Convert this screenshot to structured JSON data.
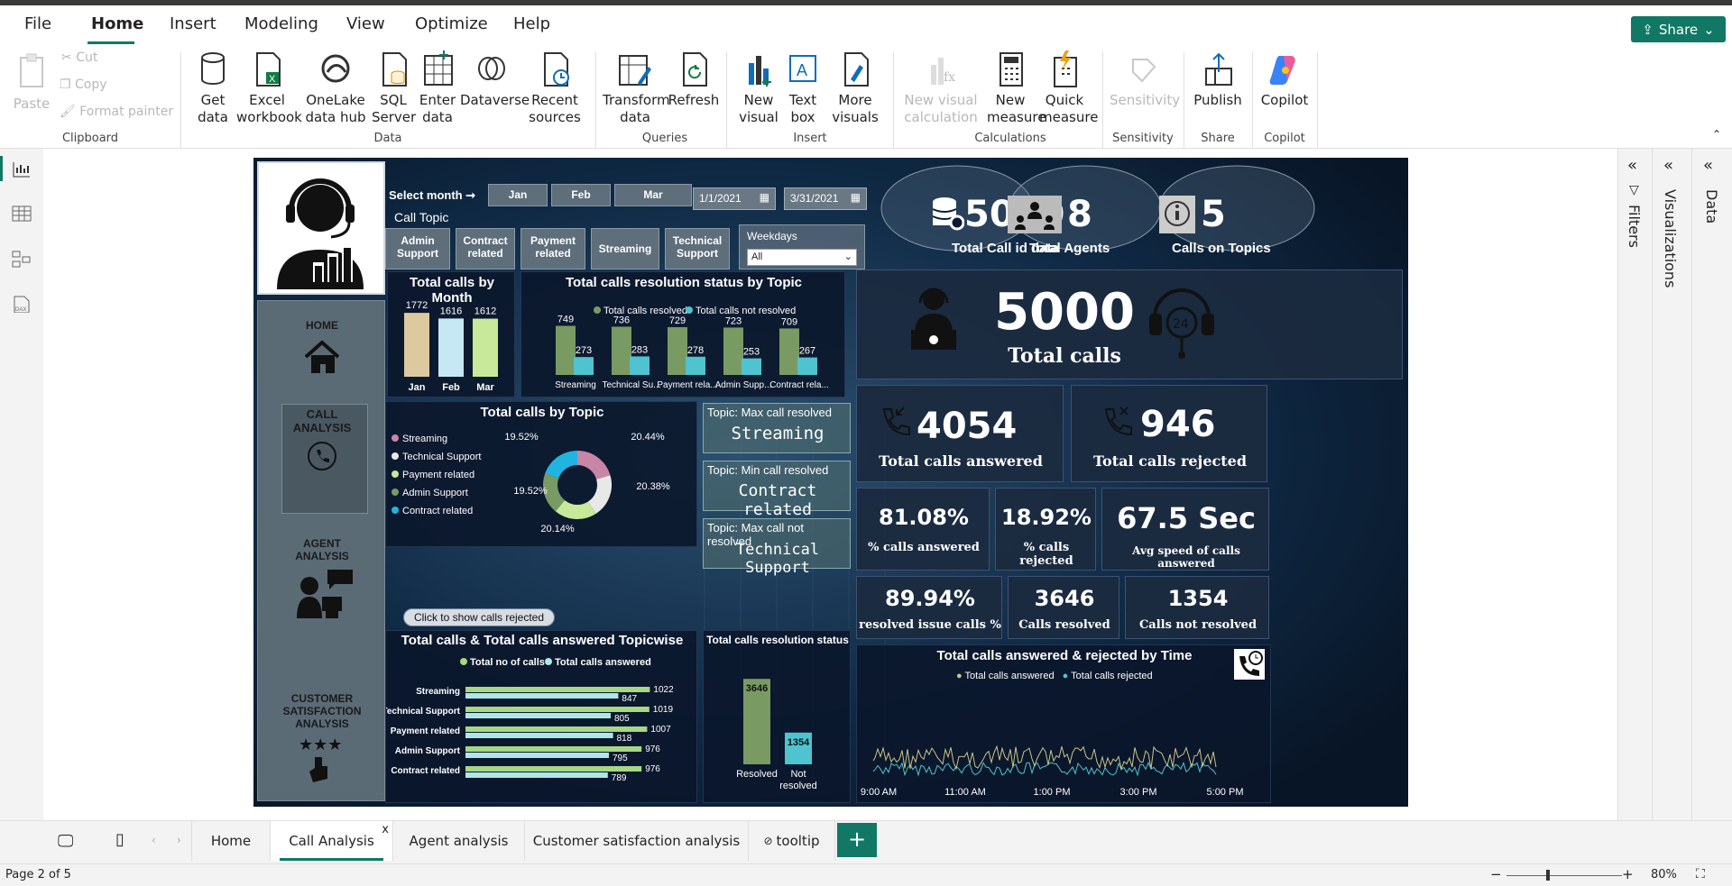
{
  "menu": {
    "file": "File",
    "home": "Home",
    "insert": "Insert",
    "modeling": "Modeling",
    "view": "View",
    "optimize": "Optimize",
    "help": "Help",
    "share": "Share"
  },
  "ribbon": {
    "paste": "Paste",
    "cut": "Cut",
    "copy": "Copy",
    "format_painter": "Format painter",
    "get_data": "Get data",
    "excel": "Excel workbook",
    "onelake": "OneLake data hub",
    "sql": "SQL Server",
    "enter_data": "Enter data",
    "dataverse": "Dataverse",
    "recent": "Recent sources",
    "transform": "Transform data",
    "refresh": "Refresh",
    "new_visual": "New visual",
    "text_box": "Text box",
    "more_visuals": "More visuals",
    "new_visual_calc": "New visual calculation",
    "new_measure": "New measure",
    "quick_measure": "Quick measure",
    "sensitivity": "Sensitivity",
    "publish": "Publish",
    "copilot": "Copilot",
    "groups": {
      "clipboard": "Clipboard",
      "data": "Data",
      "queries": "Queries",
      "insert": "Insert",
      "calculations": "Calculations",
      "sensitivity": "Sensitivity",
      "share": "Share",
      "copilot": "Copilot"
    }
  },
  "report": {
    "select_month": "Select month",
    "months": [
      "Jan",
      "Feb",
      "Mar"
    ],
    "date_from": "1/1/2021",
    "date_to": "3/31/2021",
    "call_topic_label": "Call Topic",
    "topics": [
      "Admin Support",
      "Contract related",
      "Payment related",
      "Streaming",
      "Technical Support"
    ],
    "weekdays_label": "Weekdays",
    "weekdays_value": "All",
    "nav": {
      "home": "HOME",
      "call": "CALL ANALYSIS",
      "agent": "AGENT ANALYSIS",
      "csat": "CUSTOMER SATISFACTION ANALYSIS"
    },
    "kpi_top": [
      {
        "value": "5000",
        "label": "Total Call id data"
      },
      {
        "value": "8",
        "label": "Total Agents"
      },
      {
        "value": "5",
        "label": "Calls on Topics"
      }
    ],
    "total_calls": {
      "value": "5000",
      "label": "Total calls"
    },
    "answered": {
      "value": "4054",
      "label": "Total calls answered"
    },
    "rejected": {
      "value": "946",
      "label": "Total calls rejected"
    },
    "pct_answered": {
      "value": "81.08%",
      "label": "% calls answered"
    },
    "pct_rejected": {
      "value": "18.92%",
      "label": "% calls rejected"
    },
    "avg_speed": {
      "value": "67.5 Sec",
      "label": "Avg speed of calls answered"
    },
    "resolved_pct": {
      "value": "89.94%",
      "label": "resolved issue calls %"
    },
    "calls_resolved": {
      "value": "3646",
      "label": "Calls resolved"
    },
    "calls_not_resolved": {
      "value": "1354",
      "label": "Calls not resolved"
    },
    "max_resolved": {
      "title": "Topic: Max call resolved",
      "value": "Streaming"
    },
    "min_resolved": {
      "title": "Topic: Min call resolved",
      "value": "Contract related"
    },
    "max_not_resolved": {
      "title": "Topic: Max call not resolved",
      "value": "Technical Support"
    },
    "click_rejected": "Click to show calls rejected",
    "time_chart": {
      "title": "Total calls answered & rejected by Time",
      "legend": [
        "Total calls answered",
        "Total calls rejected"
      ],
      "ticks": [
        "9:00 AM",
        "11:00 AM",
        "1:00 PM",
        "3:00 PM",
        "5:00 PM"
      ]
    }
  },
  "chart_data": [
    {
      "type": "bar",
      "title": "Total calls by Month",
      "categories": [
        "Jan",
        "Feb",
        "Mar"
      ],
      "values": [
        1772,
        1616,
        1612
      ],
      "colors": [
        "#dcc9a0",
        "#c6e8f4",
        "#c8e89a"
      ]
    },
    {
      "type": "bar",
      "title": "Total calls resolution status by Topic",
      "categories": [
        "Streaming",
        "Technical Su...",
        "Payment rela...",
        "Admin Supp...",
        "Contract rela..."
      ],
      "series": [
        {
          "name": "Total  calls resolved",
          "values": [
            749,
            736,
            729,
            723,
            709
          ],
          "color": "#7a9a63"
        },
        {
          "name": "Total calls not resolved",
          "values": [
            273,
            283,
            278,
            253,
            267
          ],
          "color": "#4fc3d0"
        }
      ]
    },
    {
      "type": "pie",
      "title": "Total calls by Topic",
      "labels": [
        "Streaming",
        "Technical Support",
        "Payment related",
        "Admin Support",
        "Contract related"
      ],
      "values": [
        20.44,
        20.38,
        20.14,
        19.52,
        19.52
      ],
      "colors": [
        "#c985a6",
        "#e8e8e8",
        "#c8e89a",
        "#7a9a63",
        "#1fb5e0"
      ],
      "label_texts": [
        "20.44%",
        "20.38%",
        "20.14%",
        "19.52%",
        "19.52%"
      ]
    },
    {
      "type": "bar",
      "title": "Total calls & Total calls answered Topicwise",
      "categories": [
        "Streaming",
        "Technical Support",
        "Payment related",
        "Admin Support",
        "Contract related"
      ],
      "series": [
        {
          "name": "Total no of calls",
          "values": [
            1022,
            1019,
            1007,
            976,
            976
          ],
          "color": "#a6d785"
        },
        {
          "name": "Total calls answered",
          "values": [
            847,
            805,
            818,
            795,
            789
          ],
          "color": "#aee6ea"
        }
      ]
    },
    {
      "type": "bar",
      "title": "Total calls resolution status",
      "categories": [
        "Resolved",
        "Not resolved"
      ],
      "values": [
        3646,
        1354
      ],
      "colors": [
        "#7a9a63",
        "#4fc3d0"
      ]
    }
  ],
  "tabs": [
    "Home",
    "Call Analysis",
    "Agent analysis",
    "Customer satisfaction analysis",
    "tooltip"
  ],
  "status": {
    "page": "Page 2 of 5",
    "zoom": "80%"
  },
  "panes": {
    "filters": "Filters",
    "visualizations": "Visualizations",
    "data": "Data"
  }
}
